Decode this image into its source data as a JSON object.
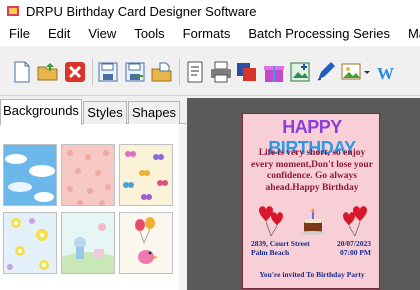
{
  "window": {
    "title": "DRPU Birthday Card Designer Software"
  },
  "menu": [
    "File",
    "Edit",
    "View",
    "Tools",
    "Formats",
    "Batch Processing Series",
    "Mail"
  ],
  "toolbar": {
    "buttons": [
      "new-icon",
      "open-folder-icon",
      "close-icon",
      "save-icon",
      "save-as-icon",
      "export-folder-icon",
      "properties-icon",
      "print-icon",
      "copy-layers-icon",
      "gift-icon",
      "add-image-icon",
      "pen-icon",
      "image-tool-icon",
      "wordart-icon"
    ],
    "wordart_label": "W"
  },
  "left_panel": {
    "tabs": [
      "Backgrounds",
      "Styles",
      "Shapes"
    ],
    "active_tab": "Backgrounds",
    "thumbnails": [
      "clouds-sky",
      "pink-pattern",
      "butterflies",
      "flowers",
      "cartoon-pastel",
      "balloons-bird"
    ]
  },
  "card": {
    "heading": [
      "HAPPY",
      "BIRTHDAY"
    ],
    "poem": "Life is very short, so enjoy every moment,Don't lose your confidence. Go always ahead.Happy Birthday",
    "address_line1": "2839, Court Street",
    "address_line2": "Palm Beach",
    "date": "20/07/2023",
    "time": "07:00 PM",
    "invite": "You're invited To Birthday Party"
  },
  "colors": {
    "card_background": "#f8cfd6",
    "poem_text": "#8b1a3a",
    "detail_text": "#1a2a8a",
    "canvas_background": "#5a5a5a"
  }
}
